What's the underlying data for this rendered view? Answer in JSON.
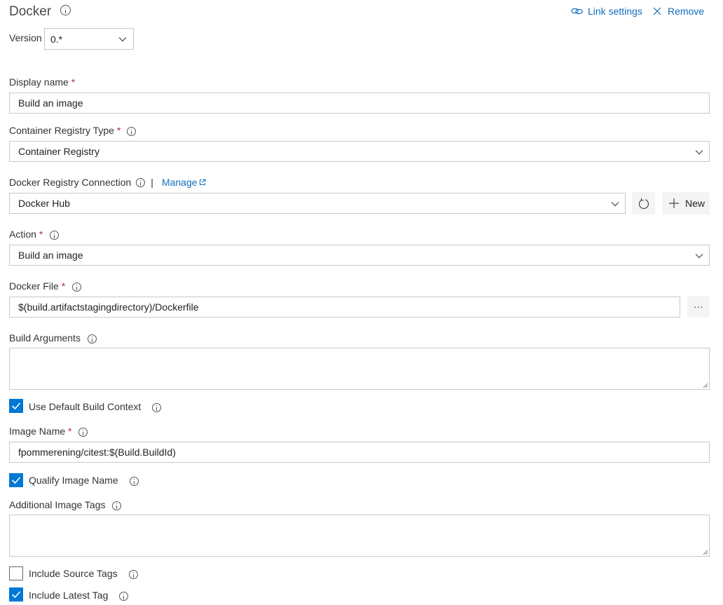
{
  "header": {
    "title": "Docker",
    "link_settings": "Link settings",
    "remove": "Remove"
  },
  "version": {
    "label": "Version",
    "value": "0.*"
  },
  "display_name": {
    "label": "Display name",
    "required": "*",
    "value": "Build an image"
  },
  "registry_type": {
    "label": "Container Registry Type",
    "required": "*",
    "value": "Container Registry"
  },
  "registry_connection": {
    "label": "Docker Registry Connection",
    "separator": "|",
    "manage": "Manage",
    "value": "Docker Hub",
    "new_label": "New"
  },
  "action": {
    "label": "Action",
    "required": "*",
    "value": "Build an image"
  },
  "docker_file": {
    "label": "Docker File",
    "required": "*",
    "value": "$(build.artifactstagingdirectory)/Dockerfile",
    "browse": "···"
  },
  "build_arguments": {
    "label": "Build Arguments",
    "value": ""
  },
  "use_default_context": {
    "label": "Use Default Build Context",
    "checked": true
  },
  "image_name": {
    "label": "Image Name",
    "required": "*",
    "value": "fpommerening/citest:$(Build.BuildId)"
  },
  "qualify_image_name": {
    "label": "Qualify Image Name",
    "checked": true
  },
  "additional_tags": {
    "label": "Additional Image Tags",
    "value": ""
  },
  "include_source_tags": {
    "label": "Include Source Tags",
    "checked": false
  },
  "include_latest_tag": {
    "label": "Include Latest Tag",
    "checked": true
  },
  "colors": {
    "accent": "#0078d4",
    "link": "#106ebe",
    "required": "#c4262e",
    "border": "#c8c8c8"
  }
}
